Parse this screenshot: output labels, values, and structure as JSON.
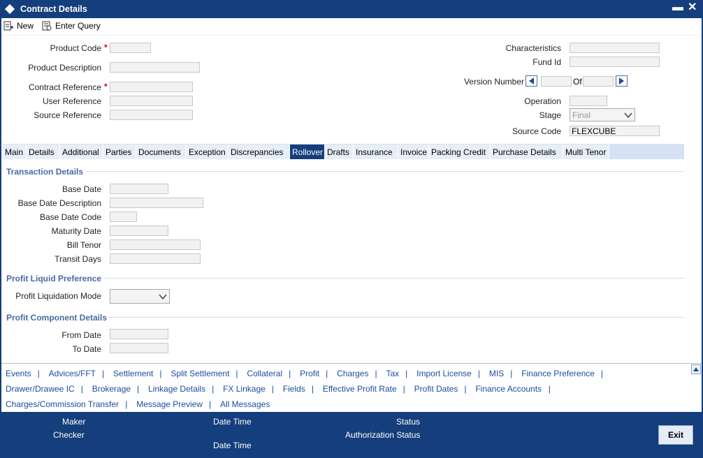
{
  "window": {
    "title": "Contract Details",
    "minimize": "▬",
    "close": "✕"
  },
  "toolbar": {
    "new_label": "New",
    "enter_query_label": "Enter Query"
  },
  "header": {
    "product_code_label": "Product Code",
    "product_description_label": "Product Description",
    "contract_reference_label": "Contract Reference",
    "user_reference_label": "User Reference",
    "source_reference_label": "Source Reference",
    "required_mark": "*",
    "characteristics_label": "Characteristics",
    "fund_id_label": "Fund Id",
    "version_number_label": "Version Number",
    "of_label": "Of",
    "operation_label": "Operation",
    "stage_label": "Stage",
    "stage_value": "Final",
    "source_code_label": "Source Code",
    "source_code_value": "FLEXCUBE"
  },
  "tabs": [
    "Main",
    "Details",
    "Additional",
    "Parties",
    "Documents",
    "Exception",
    "Discrepancies",
    "Rollover",
    "Drafts",
    "Insurance",
    "Invoice",
    "Packing Credit",
    "Purchase Details",
    "Multi Tenor"
  ],
  "active_tab": "Rollover",
  "transaction": {
    "section_title": "Transaction Details",
    "base_date_label": "Base Date",
    "base_date_description_label": "Base Date Description",
    "base_date_code_label": "Base Date Code",
    "maturity_date_label": "Maturity Date",
    "bill_tenor_label": "Bill Tenor",
    "transit_days_label": "Transit Days"
  },
  "profit_liquid": {
    "section_title": "Profit Liquid Preference",
    "mode_label": "Profit Liquidation Mode"
  },
  "profit_component": {
    "section_title": "Profit Component Details",
    "from_date_label": "From Date",
    "to_date_label": "To Date"
  },
  "links": {
    "row1": [
      "Events",
      "Advices/FFT",
      "Settlement",
      "Split Settlement",
      "Collateral",
      "Profit",
      "Charges",
      "Tax",
      "Import License",
      "MIS",
      "Finance Preference"
    ],
    "row2": [
      "Drawer/Drawee IC",
      "Brokerage",
      "Linkage Details",
      "FX Linkage",
      "Fields",
      "Effective Profit Rate",
      "Profit Dates",
      "Finance Accounts"
    ],
    "row3": [
      "Charges/Commission Transfer",
      "Message Preview",
      "All Messages"
    ],
    "separator": "|"
  },
  "footer": {
    "maker_label": "Maker",
    "checker_label": "Checker",
    "date_time_label": "Date Time",
    "status_label": "Status",
    "authorization_status_label": "Authorization Status",
    "exit_label": "Exit"
  },
  "colors": {
    "titlebar": "#143e7c",
    "tab_active": "#143e7c",
    "section": "#4a6aa0",
    "link": "#1a4d9c"
  }
}
